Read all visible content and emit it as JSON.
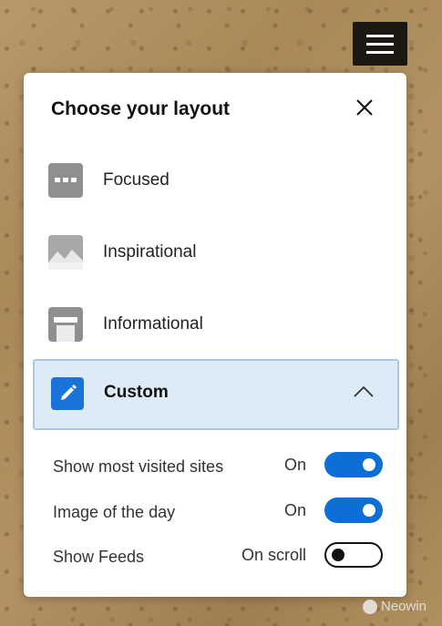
{
  "panel": {
    "title": "Choose your layout",
    "close_icon": "close-icon"
  },
  "options": [
    {
      "label": "Focused",
      "icon": "focused-layout-icon"
    },
    {
      "label": "Inspirational",
      "icon": "inspirational-layout-icon"
    },
    {
      "label": "Informational",
      "icon": "informational-layout-icon"
    }
  ],
  "custom": {
    "label": "Custom",
    "icon": "pencil-icon",
    "expand_icon": "chevron-up-icon",
    "accent_color": "#1a73d9"
  },
  "settings": [
    {
      "label": "Show most visited sites",
      "value": "On",
      "state": "on"
    },
    {
      "label": "Image of the day",
      "value": "On",
      "state": "on"
    },
    {
      "label": "Show Feeds",
      "value": "On scroll",
      "state": "off"
    }
  ],
  "watermark": {
    "text": "Neowin"
  }
}
